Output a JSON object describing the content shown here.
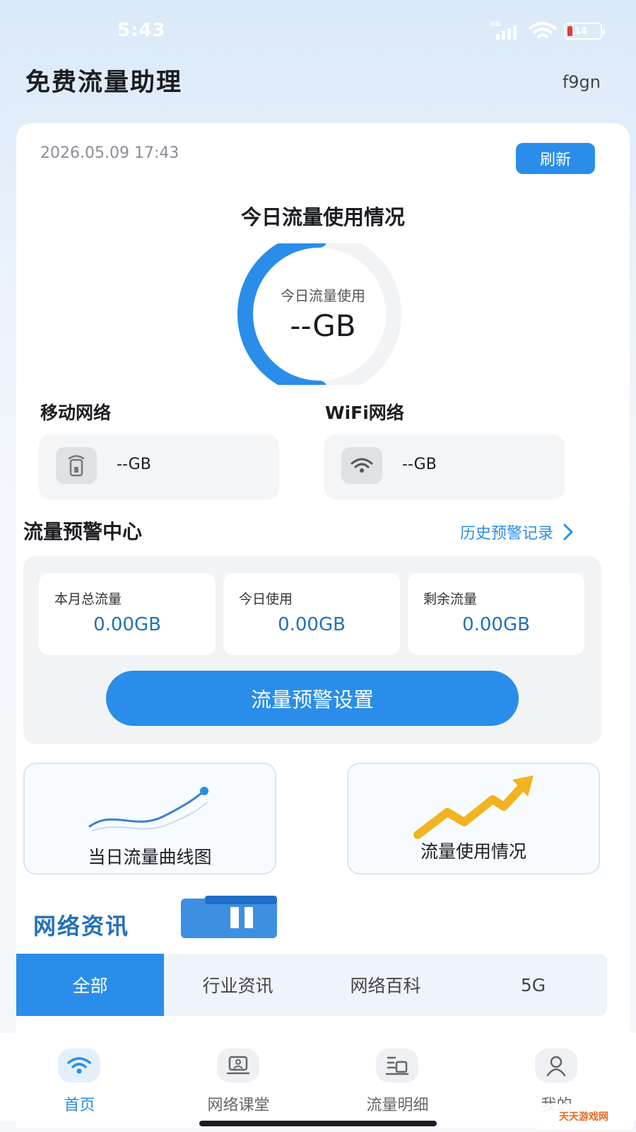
{
  "status_bar": {
    "time": "5:43",
    "network_type": "HD",
    "battery_level": "14"
  },
  "header": {
    "title": "免费流量助理",
    "user_code": "f9gn"
  },
  "usage_card": {
    "datetime": "2026.05.09 17:43",
    "refresh_label": "刷新",
    "section_title": "今日流量使用情况",
    "gauge_label": "今日流量使用",
    "gauge_value": "--GB",
    "gauge_fill_fraction": 0.5,
    "mobile": {
      "label": "移动网络",
      "value": "--GB",
      "icon": "mobile-phone-icon"
    },
    "wifi": {
      "label": "WiFi网络",
      "value": "--GB",
      "icon": "wifi-icon"
    }
  },
  "warning_center": {
    "title": "流量预警中心",
    "history_link": "历史预警记录",
    "stats": [
      {
        "label": "本月总流量",
        "value": "0.00GB"
      },
      {
        "label": "今日使用",
        "value": "0.00GB"
      },
      {
        "label": "剩余流量",
        "value": "0.00GB"
      }
    ],
    "settings_button": "流量预警设置"
  },
  "features": [
    {
      "label": "当日流量曲线图",
      "icon": "curve-chart-icon"
    },
    {
      "label": "流量使用情况",
      "icon": "trend-arrow-icon"
    }
  ],
  "news": {
    "title": "网络资讯",
    "tabs": [
      {
        "label": "全部",
        "active": true
      },
      {
        "label": "行业资讯",
        "active": false
      },
      {
        "label": "网络百科",
        "active": false
      },
      {
        "label": "5G",
        "active": false
      }
    ]
  },
  "bottom_nav": [
    {
      "label": "首页",
      "icon": "wifi-icon",
      "active": true
    },
    {
      "label": "网络课堂",
      "icon": "laptop-user-icon",
      "active": false
    },
    {
      "label": "流量明细",
      "icon": "detail-list-icon",
      "active": false
    },
    {
      "label": "我的",
      "icon": "user-icon",
      "active": false
    }
  ],
  "watermark": "天天游戏网",
  "colors": {
    "accent": "#2a8de9",
    "value_blue": "#2470b8",
    "panel": "#f2f3f5"
  }
}
